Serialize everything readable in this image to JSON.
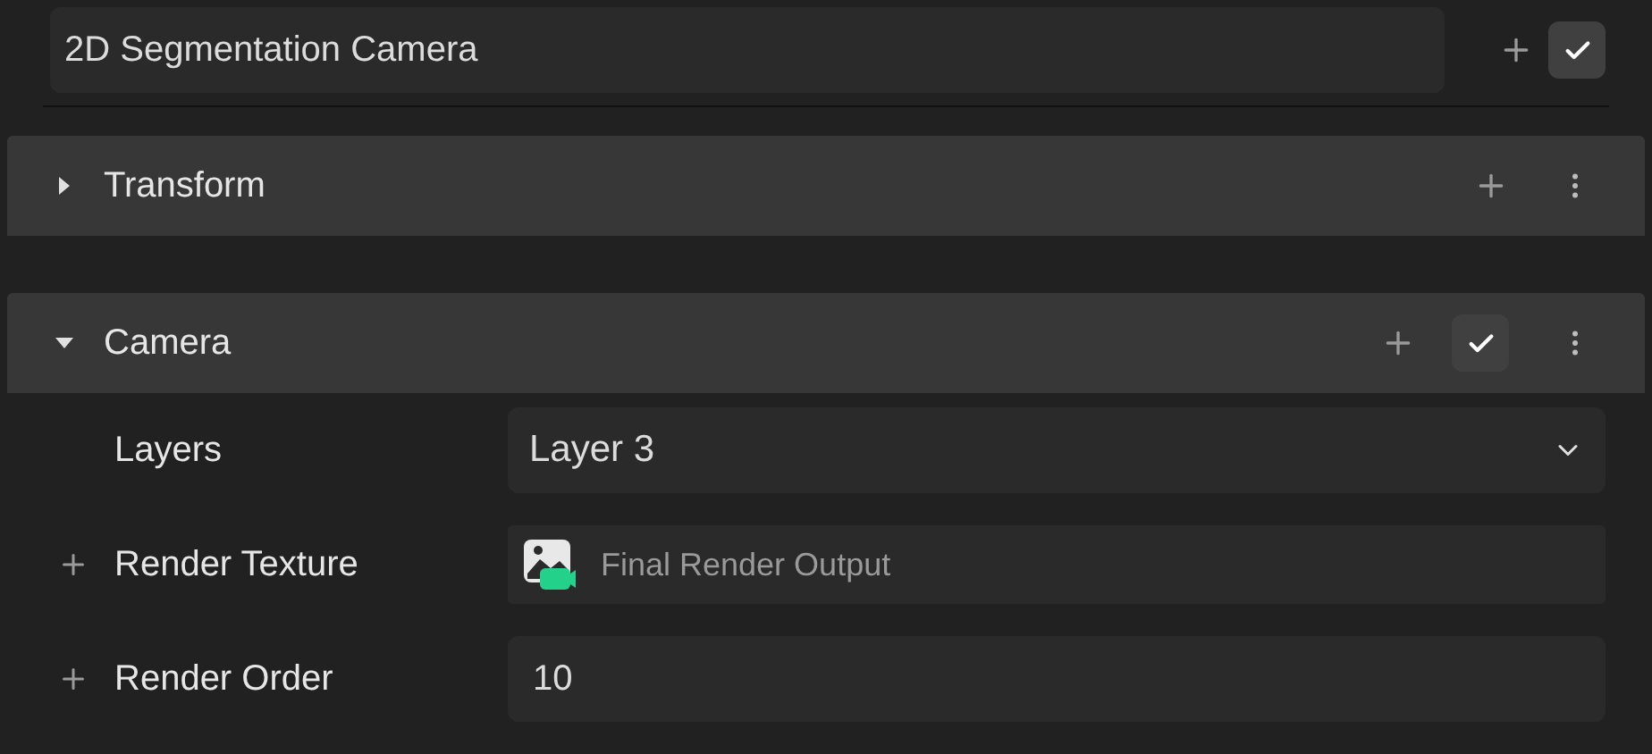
{
  "object": {
    "name": "2D Segmentation Camera",
    "enabled": true
  },
  "components": [
    {
      "title": "Transform",
      "expanded": false,
      "has_toggle": false
    },
    {
      "title": "Camera",
      "expanded": true,
      "has_toggle": true,
      "enabled": true,
      "properties": [
        {
          "kind": "dropdown",
          "label": "Layers",
          "value": "Layer 3",
          "addable": false
        },
        {
          "kind": "asset",
          "label": "Render Texture",
          "value": "Final Render Output",
          "addable": true
        },
        {
          "kind": "number",
          "label": "Render Order",
          "value": "10",
          "addable": true
        }
      ]
    }
  ]
}
